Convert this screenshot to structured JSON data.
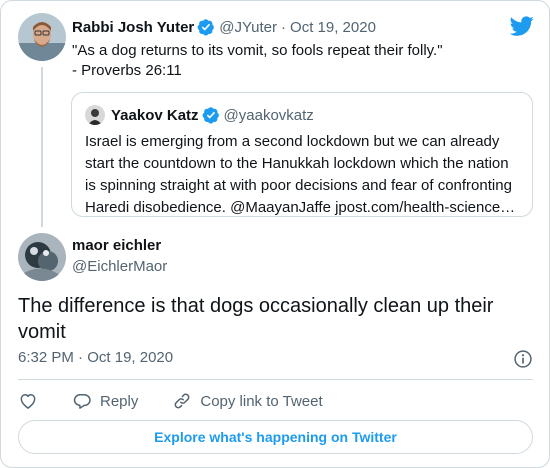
{
  "brand": {
    "icon": "twitter-bird-icon",
    "color": "#1d9bf0"
  },
  "parent_tweet": {
    "author_name": "Rabbi Josh Yuter",
    "author_handle": "@JYuter",
    "separator": "·",
    "date": "Oct 19, 2020",
    "verified": true,
    "text_lines": [
      "\"As a dog returns to its vomit, so fools repeat their folly.\"",
      "- Proverbs 26:11"
    ]
  },
  "quoted_tweet": {
    "author_name": "Yaakov Katz",
    "author_handle": "@yaakovkatz",
    "verified": true,
    "text_lines": [
      "Israel is emerging from a second lockdown but we can already",
      "start the countdown to the Hanukkah lockdown which the nation",
      "is spinning straight at with poor decisions and fear of confronting",
      "Haredi disobedience. @MaayanJaffe jpost.com/health-science…"
    ]
  },
  "main_tweet": {
    "author_name": "maor eichler",
    "author_handle": "@EichlerMaor",
    "text": "The difference is that dogs occasionally clean up their vomit",
    "time": "6:32 PM",
    "separator": "·",
    "date": "Oct 19, 2020"
  },
  "actions": {
    "like_icon": "heart-icon",
    "reply_label": "Reply",
    "copy_link_label": "Copy link to Tweet"
  },
  "explore_label": "Explore what's happening on Twitter"
}
